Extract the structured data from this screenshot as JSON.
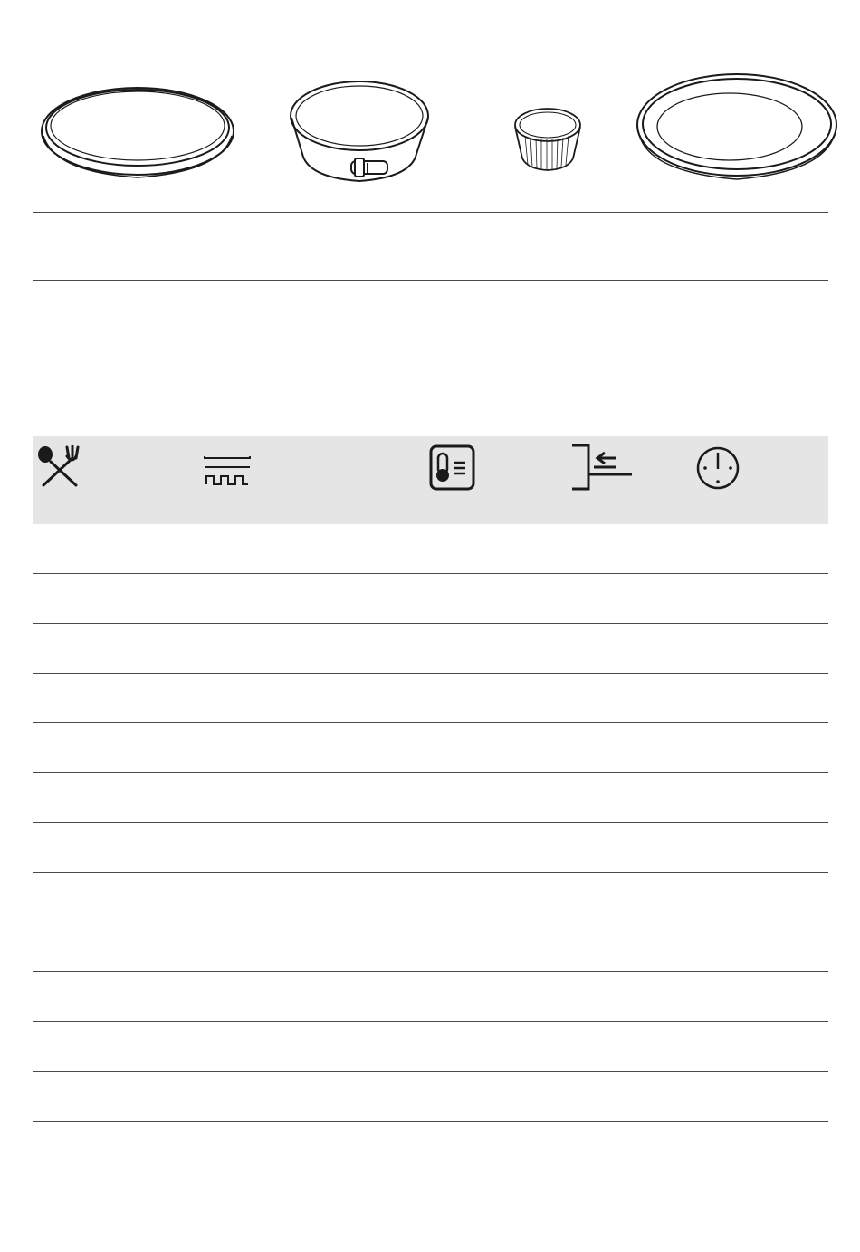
{
  "cookware": [
    {
      "name": "flat-baking-tray-icon"
    },
    {
      "name": "springform-pan-icon"
    },
    {
      "name": "ramekin-icon"
    },
    {
      "name": "cake-tin-icon"
    }
  ],
  "table": {
    "header_icons": [
      {
        "name": "food-icon"
      },
      {
        "name": "heating-function-icon"
      },
      {
        "name": "temperature-icon"
      },
      {
        "name": "shelf-position-icon"
      },
      {
        "name": "time-icon"
      }
    ],
    "row_count": 12
  },
  "colors": {
    "line": "#4a4a4a",
    "header_bg": "#e5e5e5",
    "icon": "#1a1a1a"
  }
}
